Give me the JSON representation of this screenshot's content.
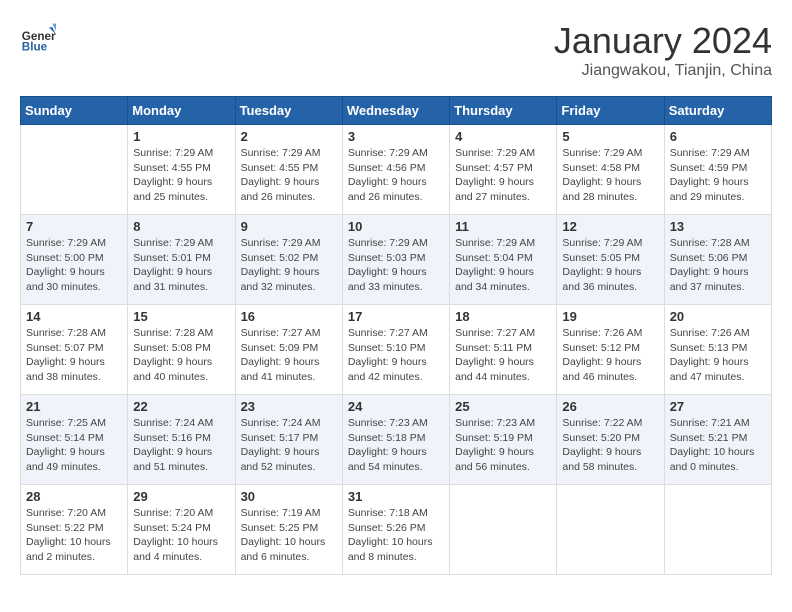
{
  "header": {
    "logo_general": "General",
    "logo_blue": "Blue",
    "title": "January 2024",
    "subtitle": "Jiangwakou, Tianjin, China"
  },
  "weekdays": [
    "Sunday",
    "Monday",
    "Tuesday",
    "Wednesday",
    "Thursday",
    "Friday",
    "Saturday"
  ],
  "weeks": [
    [
      {
        "day": "",
        "sunrise": "",
        "sunset": "",
        "daylight": ""
      },
      {
        "day": "1",
        "sunrise": "Sunrise: 7:29 AM",
        "sunset": "Sunset: 4:55 PM",
        "daylight": "Daylight: 9 hours and 25 minutes."
      },
      {
        "day": "2",
        "sunrise": "Sunrise: 7:29 AM",
        "sunset": "Sunset: 4:55 PM",
        "daylight": "Daylight: 9 hours and 26 minutes."
      },
      {
        "day": "3",
        "sunrise": "Sunrise: 7:29 AM",
        "sunset": "Sunset: 4:56 PM",
        "daylight": "Daylight: 9 hours and 26 minutes."
      },
      {
        "day": "4",
        "sunrise": "Sunrise: 7:29 AM",
        "sunset": "Sunset: 4:57 PM",
        "daylight": "Daylight: 9 hours and 27 minutes."
      },
      {
        "day": "5",
        "sunrise": "Sunrise: 7:29 AM",
        "sunset": "Sunset: 4:58 PM",
        "daylight": "Daylight: 9 hours and 28 minutes."
      },
      {
        "day": "6",
        "sunrise": "Sunrise: 7:29 AM",
        "sunset": "Sunset: 4:59 PM",
        "daylight": "Daylight: 9 hours and 29 minutes."
      }
    ],
    [
      {
        "day": "7",
        "sunrise": "Sunrise: 7:29 AM",
        "sunset": "Sunset: 5:00 PM",
        "daylight": "Daylight: 9 hours and 30 minutes."
      },
      {
        "day": "8",
        "sunrise": "Sunrise: 7:29 AM",
        "sunset": "Sunset: 5:01 PM",
        "daylight": "Daylight: 9 hours and 31 minutes."
      },
      {
        "day": "9",
        "sunrise": "Sunrise: 7:29 AM",
        "sunset": "Sunset: 5:02 PM",
        "daylight": "Daylight: 9 hours and 32 minutes."
      },
      {
        "day": "10",
        "sunrise": "Sunrise: 7:29 AM",
        "sunset": "Sunset: 5:03 PM",
        "daylight": "Daylight: 9 hours and 33 minutes."
      },
      {
        "day": "11",
        "sunrise": "Sunrise: 7:29 AM",
        "sunset": "Sunset: 5:04 PM",
        "daylight": "Daylight: 9 hours and 34 minutes."
      },
      {
        "day": "12",
        "sunrise": "Sunrise: 7:29 AM",
        "sunset": "Sunset: 5:05 PM",
        "daylight": "Daylight: 9 hours and 36 minutes."
      },
      {
        "day": "13",
        "sunrise": "Sunrise: 7:28 AM",
        "sunset": "Sunset: 5:06 PM",
        "daylight": "Daylight: 9 hours and 37 minutes."
      }
    ],
    [
      {
        "day": "14",
        "sunrise": "Sunrise: 7:28 AM",
        "sunset": "Sunset: 5:07 PM",
        "daylight": "Daylight: 9 hours and 38 minutes."
      },
      {
        "day": "15",
        "sunrise": "Sunrise: 7:28 AM",
        "sunset": "Sunset: 5:08 PM",
        "daylight": "Daylight: 9 hours and 40 minutes."
      },
      {
        "day": "16",
        "sunrise": "Sunrise: 7:27 AM",
        "sunset": "Sunset: 5:09 PM",
        "daylight": "Daylight: 9 hours and 41 minutes."
      },
      {
        "day": "17",
        "sunrise": "Sunrise: 7:27 AM",
        "sunset": "Sunset: 5:10 PM",
        "daylight": "Daylight: 9 hours and 42 minutes."
      },
      {
        "day": "18",
        "sunrise": "Sunrise: 7:27 AM",
        "sunset": "Sunset: 5:11 PM",
        "daylight": "Daylight: 9 hours and 44 minutes."
      },
      {
        "day": "19",
        "sunrise": "Sunrise: 7:26 AM",
        "sunset": "Sunset: 5:12 PM",
        "daylight": "Daylight: 9 hours and 46 minutes."
      },
      {
        "day": "20",
        "sunrise": "Sunrise: 7:26 AM",
        "sunset": "Sunset: 5:13 PM",
        "daylight": "Daylight: 9 hours and 47 minutes."
      }
    ],
    [
      {
        "day": "21",
        "sunrise": "Sunrise: 7:25 AM",
        "sunset": "Sunset: 5:14 PM",
        "daylight": "Daylight: 9 hours and 49 minutes."
      },
      {
        "day": "22",
        "sunrise": "Sunrise: 7:24 AM",
        "sunset": "Sunset: 5:16 PM",
        "daylight": "Daylight: 9 hours and 51 minutes."
      },
      {
        "day": "23",
        "sunrise": "Sunrise: 7:24 AM",
        "sunset": "Sunset: 5:17 PM",
        "daylight": "Daylight: 9 hours and 52 minutes."
      },
      {
        "day": "24",
        "sunrise": "Sunrise: 7:23 AM",
        "sunset": "Sunset: 5:18 PM",
        "daylight": "Daylight: 9 hours and 54 minutes."
      },
      {
        "day": "25",
        "sunrise": "Sunrise: 7:23 AM",
        "sunset": "Sunset: 5:19 PM",
        "daylight": "Daylight: 9 hours and 56 minutes."
      },
      {
        "day": "26",
        "sunrise": "Sunrise: 7:22 AM",
        "sunset": "Sunset: 5:20 PM",
        "daylight": "Daylight: 9 hours and 58 minutes."
      },
      {
        "day": "27",
        "sunrise": "Sunrise: 7:21 AM",
        "sunset": "Sunset: 5:21 PM",
        "daylight": "Daylight: 10 hours and 0 minutes."
      }
    ],
    [
      {
        "day": "28",
        "sunrise": "Sunrise: 7:20 AM",
        "sunset": "Sunset: 5:22 PM",
        "daylight": "Daylight: 10 hours and 2 minutes."
      },
      {
        "day": "29",
        "sunrise": "Sunrise: 7:20 AM",
        "sunset": "Sunset: 5:24 PM",
        "daylight": "Daylight: 10 hours and 4 minutes."
      },
      {
        "day": "30",
        "sunrise": "Sunrise: 7:19 AM",
        "sunset": "Sunset: 5:25 PM",
        "daylight": "Daylight: 10 hours and 6 minutes."
      },
      {
        "day": "31",
        "sunrise": "Sunrise: 7:18 AM",
        "sunset": "Sunset: 5:26 PM",
        "daylight": "Daylight: 10 hours and 8 minutes."
      },
      {
        "day": "",
        "sunrise": "",
        "sunset": "",
        "daylight": ""
      },
      {
        "day": "",
        "sunrise": "",
        "sunset": "",
        "daylight": ""
      },
      {
        "day": "",
        "sunrise": "",
        "sunset": "",
        "daylight": ""
      }
    ]
  ]
}
